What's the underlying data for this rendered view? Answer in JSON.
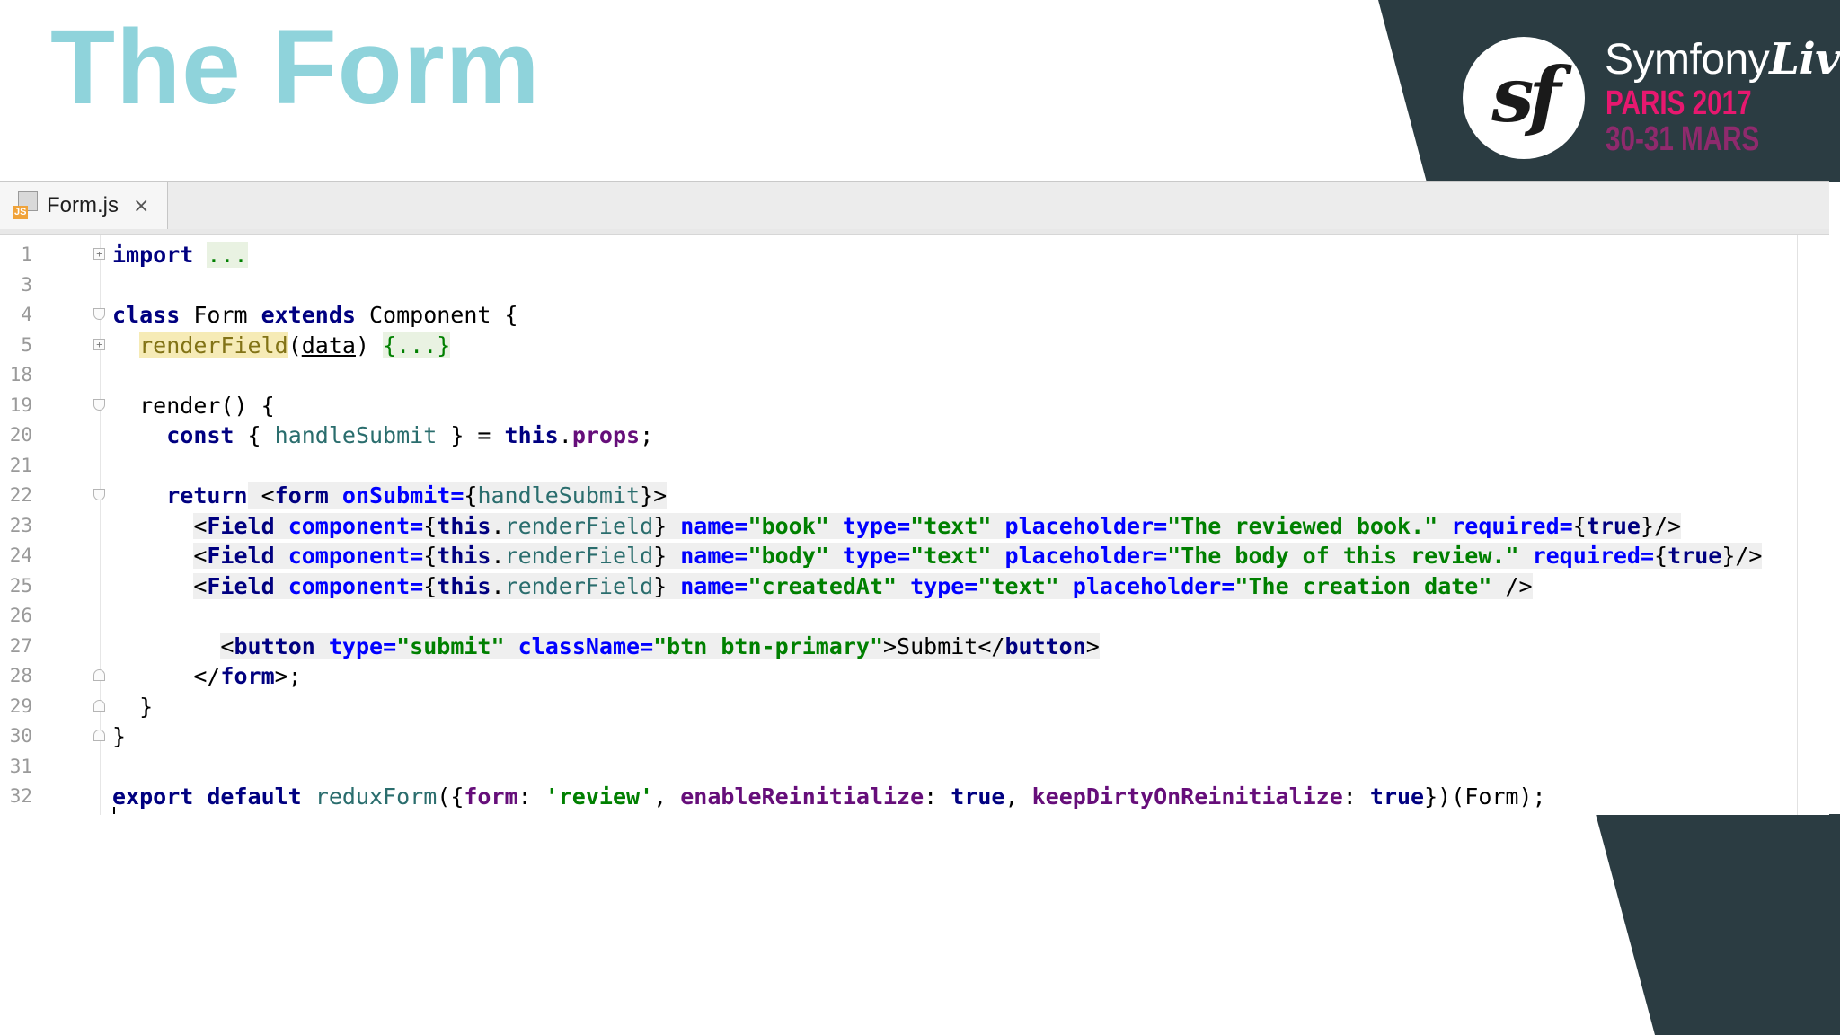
{
  "slide": {
    "title": "The Form"
  },
  "brand": {
    "logo_text": "sf",
    "name_prefix": "Symfony",
    "name_suffix": "Live",
    "line1": "PARIS 2017",
    "line2": "30-31 MARS"
  },
  "colors": {
    "title": "#8fd3db",
    "dark_shape": "#2b3c42",
    "brand_pink": "#e7186f",
    "brand_purple": "#8f2a6d"
  },
  "editor": {
    "tab": {
      "label": "Form.js",
      "close": "×",
      "icon_label": "JS"
    },
    "line_numbers": [
      "1",
      "3",
      "4",
      "5",
      "18",
      "19",
      "20",
      "21",
      "22",
      "23",
      "24",
      "25",
      "26",
      "27",
      "28",
      "29",
      "30",
      "31",
      "32"
    ],
    "lines": {
      "l1": {
        "kw": "import",
        "rest": " ",
        "fold": "..."
      },
      "l4": {
        "kw1": "class",
        "t1": " Form ",
        "kw2": "extends",
        "t2": " Component {"
      },
      "l5": {
        "indent": "  ",
        "method": "renderField",
        "t1": "(",
        "arg": "data",
        "t2": ") ",
        "fold": "{...}"
      },
      "l19": {
        "indent": "  ",
        "fn": "render",
        "t1": "() {"
      },
      "l20": {
        "indent": "    ",
        "kw": "const",
        "t1": " { ",
        "var": "handleSubmit",
        "t2": " } = ",
        "kw2": "this",
        "t3": ".",
        "prop": "props",
        "t4": ";"
      },
      "l22": {
        "indent": "    ",
        "kw": "return",
        "t1": " <",
        "tag": "form",
        "t2": " ",
        "attr": "onSubmit=",
        "t3": "{",
        "var": "handleSubmit",
        "t4": "}>"
      },
      "l23": {
        "indent": "      ",
        "t1": "<",
        "tag": "Field",
        "t2": " ",
        "attr1": "component=",
        "t3": "{",
        "kw": "this",
        "t4": ".",
        "fn": "renderField",
        "t5": "} ",
        "attr2": "name=",
        "v2": "\"book\"",
        "t6": " ",
        "attr3": "type=",
        "v3": "\"text\"",
        "t7": " ",
        "attr4": "placeholder=",
        "v4": "\"The reviewed book.\"",
        "t8": " ",
        "attr5": "required=",
        "t9": "{",
        "kw2": "true",
        "t10": "}/>"
      },
      "l24": {
        "indent": "      ",
        "t1": "<",
        "tag": "Field",
        "t2": " ",
        "attr1": "component=",
        "t3": "{",
        "kw": "this",
        "t4": ".",
        "fn": "renderField",
        "t5": "} ",
        "attr2": "name=",
        "v2": "\"body\"",
        "t6": " ",
        "attr3": "type=",
        "v3": "\"text\"",
        "t7": " ",
        "attr4": "placeholder=",
        "v4": "\"The body of this review.\"",
        "t8": " ",
        "attr5": "required=",
        "t9": "{",
        "kw2": "true",
        "t10": "}/>"
      },
      "l25": {
        "indent": "      ",
        "t1": "<",
        "tag": "Field",
        "t2": " ",
        "attr1": "component=",
        "t3": "{",
        "kw": "this",
        "t4": ".",
        "fn": "renderField",
        "t5": "} ",
        "attr2": "name=",
        "v2": "\"createdAt\"",
        "t6": " ",
        "attr3": "type=",
        "v3": "\"text\"",
        "t7": " ",
        "attr4": "placeholder=",
        "v4": "\"The creation date\"",
        "t8": " />"
      },
      "l27": {
        "indent": "        ",
        "t1": "<",
        "tag": "button",
        "t2": " ",
        "attr1": "type=",
        "v1": "\"submit\"",
        "t3": " ",
        "attr2": "className=",
        "v2": "\"btn btn-primary\"",
        "t4": ">Submit</",
        "tag2": "button",
        "t5": ">"
      },
      "l28": {
        "indent": "      ",
        "t1": "</",
        "tag": "form",
        "t2": ">;"
      },
      "l29": {
        "indent": "  ",
        "t1": "}"
      },
      "l30": {
        "t1": "}"
      },
      "l32": {
        "kw1": "export",
        "t1": " ",
        "kw2": "default",
        "t2": " ",
        "fn": "reduxForm",
        "t3": "({",
        "p1": "form",
        "t4": ": ",
        "s1": "'review'",
        "t5": ", ",
        "p2": "enableReinitialize",
        "t6": ": ",
        "kw3": "true",
        "t7": ", ",
        "p3": "keepDirtyOnReinitialize",
        "t8": ": ",
        "kw4": "true",
        "t9": "})(Form);"
      }
    }
  }
}
